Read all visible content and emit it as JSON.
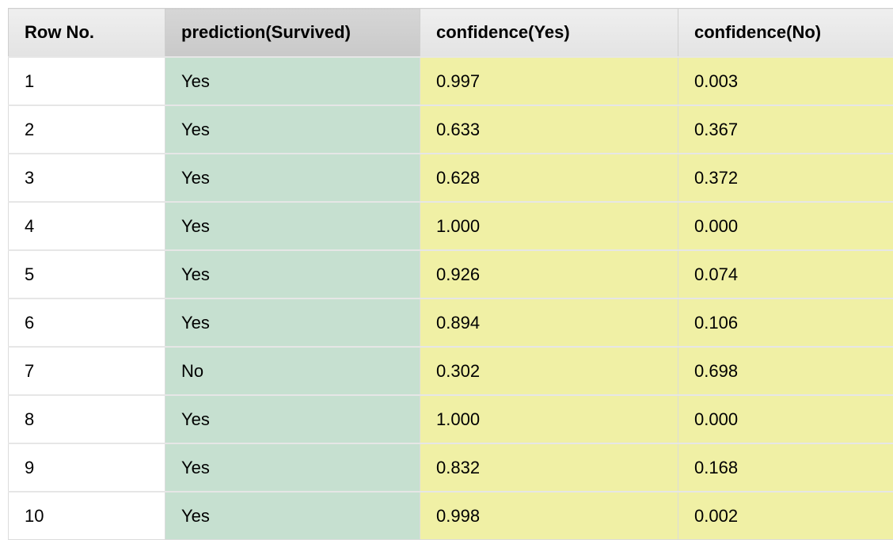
{
  "table": {
    "columns": [
      "Row No.",
      "prediction(Survived)",
      "confidence(Yes)",
      "confidence(No)"
    ],
    "rows": [
      {
        "row_no": "1",
        "prediction": "Yes",
        "conf_yes": "0.997",
        "conf_no": "0.003"
      },
      {
        "row_no": "2",
        "prediction": "Yes",
        "conf_yes": "0.633",
        "conf_no": "0.367"
      },
      {
        "row_no": "3",
        "prediction": "Yes",
        "conf_yes": "0.628",
        "conf_no": "0.372"
      },
      {
        "row_no": "4",
        "prediction": "Yes",
        "conf_yes": "1.000",
        "conf_no": "0.000"
      },
      {
        "row_no": "5",
        "prediction": "Yes",
        "conf_yes": "0.926",
        "conf_no": "0.074"
      },
      {
        "row_no": "6",
        "prediction": "Yes",
        "conf_yes": "0.894",
        "conf_no": "0.106"
      },
      {
        "row_no": "7",
        "prediction": "No",
        "conf_yes": "0.302",
        "conf_no": "0.698"
      },
      {
        "row_no": "8",
        "prediction": "Yes",
        "conf_yes": "1.000",
        "conf_no": "0.000"
      },
      {
        "row_no": "9",
        "prediction": "Yes",
        "conf_yes": "0.832",
        "conf_no": "0.168"
      },
      {
        "row_no": "10",
        "prediction": "Yes",
        "conf_yes": "0.998",
        "conf_no": "0.002"
      }
    ]
  },
  "colors": {
    "prediction_column": "#c6e0d0",
    "confidence_columns": "#f0f0a5",
    "header": "#e8e8e8",
    "header_selected": "#cfcfcf"
  }
}
